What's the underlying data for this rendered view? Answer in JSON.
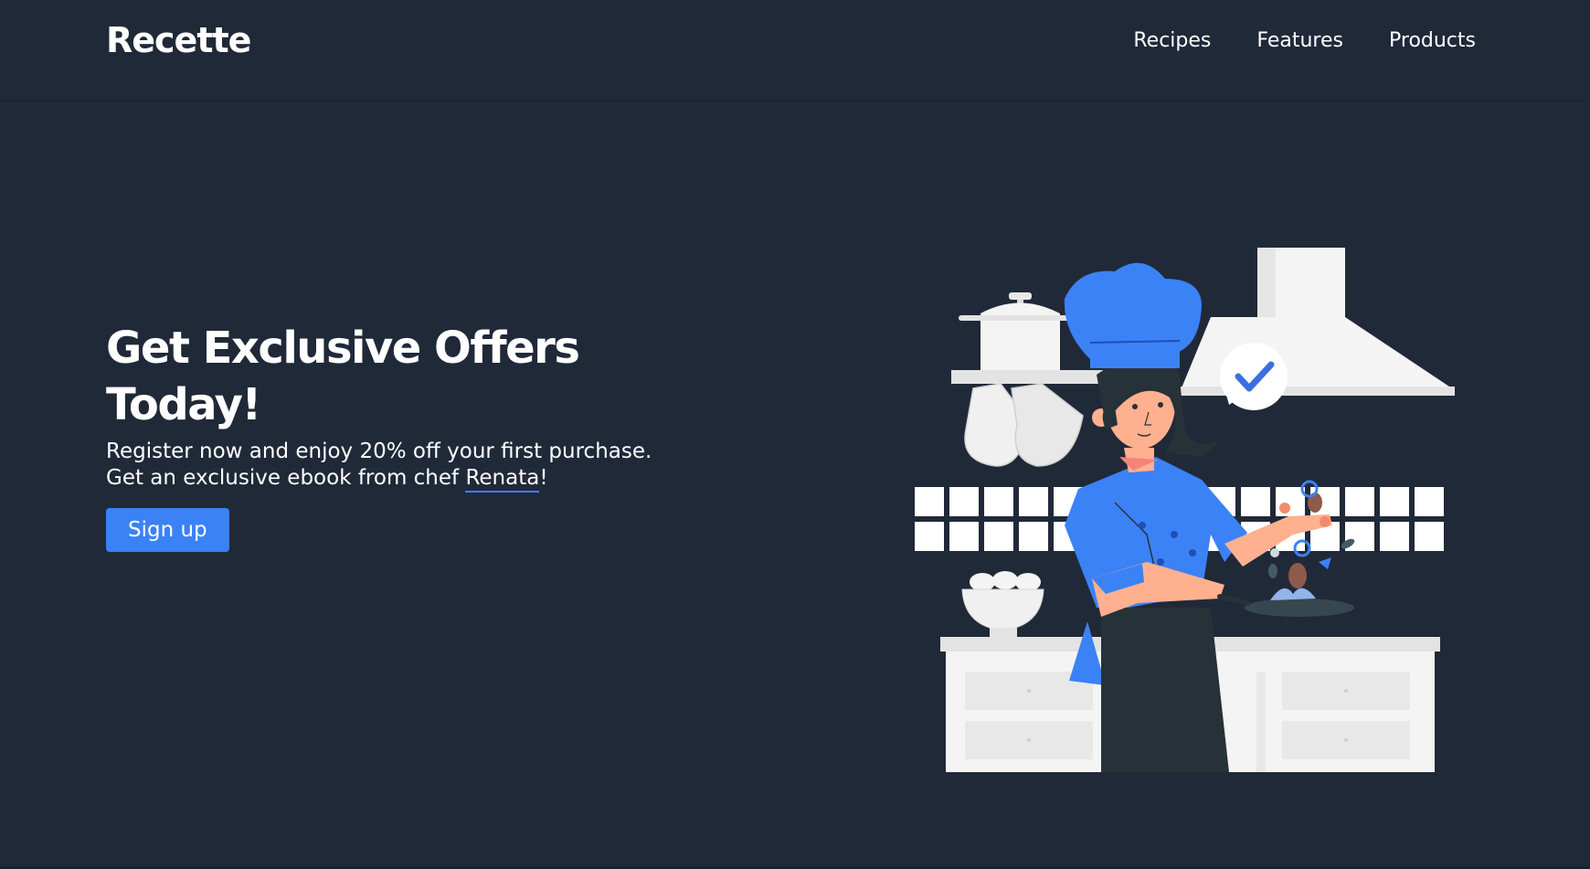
{
  "brand": {
    "name": "Recette"
  },
  "nav": {
    "items": [
      {
        "label": "Recipes"
      },
      {
        "label": "Features"
      },
      {
        "label": "Products"
      }
    ]
  },
  "hero": {
    "title": "Get Exclusive Offers Today!",
    "line1": "Register now and enjoy 20% off your first purchase.",
    "line2_prefix": "Get an exclusive ebook from chef ",
    "chef_name": "Renata",
    "line2_suffix": "!",
    "cta_label": "Sign up"
  },
  "colors": {
    "background": "#202938",
    "accent": "#3b82f6",
    "text": "#ffffff"
  },
  "illustration": {
    "subject": "chef-cooking-illustration"
  }
}
